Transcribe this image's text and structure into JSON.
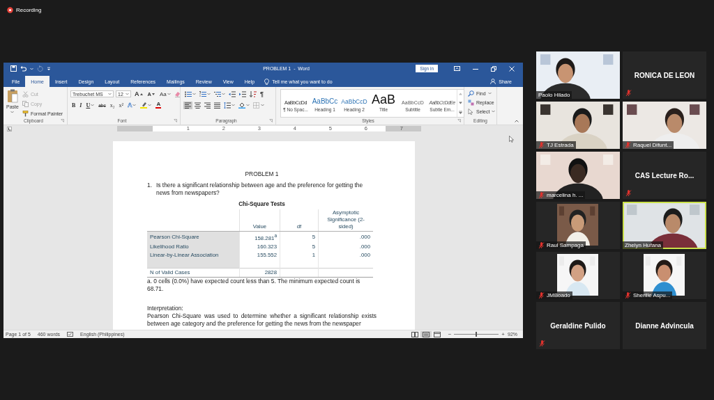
{
  "recording": {
    "label": "Recording"
  },
  "word": {
    "redo": {
      "disabled": true
    },
    "title": "PROBLEM 1  -  Word",
    "sign_in": "Sign in",
    "tabs": [
      {
        "label": "File",
        "selected": false
      },
      {
        "label": "Home",
        "selected": true
      },
      {
        "label": "Insert",
        "selected": false
      },
      {
        "label": "Design",
        "selected": false
      },
      {
        "label": "Layout",
        "selected": false
      },
      {
        "label": "References",
        "selected": false
      },
      {
        "label": "Mailings",
        "selected": false
      },
      {
        "label": "Review",
        "selected": false
      },
      {
        "label": "View",
        "selected": false
      },
      {
        "label": "Help",
        "selected": false
      }
    ],
    "tell_me": "Tell me what you want to do",
    "share": "Share",
    "clipboard": {
      "label": "Clipboard",
      "paste": "Paste",
      "items": [
        {
          "label": "Cut",
          "kind": "cut",
          "disabled": true
        },
        {
          "label": "Copy",
          "kind": "copy",
          "disabled": true
        },
        {
          "label": "Format Painter",
          "kind": "painter",
          "disabled": false
        }
      ]
    },
    "font": {
      "label": "Font",
      "name": "Trebuchet MS",
      "size": "12",
      "grow": "A",
      "shrink": "A",
      "change_case": "Aa",
      "formats": [
        {
          "label": "B",
          "kind": "bold"
        },
        {
          "label": "I",
          "kind": "italic"
        },
        {
          "label": "U",
          "kind": "underline"
        },
        {
          "label": "abc",
          "kind": "strike"
        },
        {
          "label": "x₂",
          "kind": "sub"
        },
        {
          "label": "x²",
          "kind": "sup"
        }
      ],
      "effects": "A",
      "font_color": "A"
    },
    "paragraph": {
      "label": "Paragraph",
      "show_marks": "¶",
      "alignment": [
        {
          "kind": "left",
          "selected": true
        },
        {
          "kind": "center",
          "selected": false
        },
        {
          "kind": "right",
          "selected": false
        },
        {
          "kind": "justify",
          "selected": false
        }
      ]
    },
    "styles": {
      "label": "Styles",
      "items": [
        {
          "preview": "AaBbCcDd",
          "name": "¶ No Spac...",
          "kind": "nospacing"
        },
        {
          "preview": "AaBbCc",
          "name": "Heading 1",
          "kind": "heading1"
        },
        {
          "preview": "AaBbCcD",
          "name": "Heading 2",
          "kind": "heading2"
        },
        {
          "preview": "AaB",
          "name": "Title",
          "kind": "title"
        },
        {
          "preview": "AaBbCcD",
          "name": "Subtitle",
          "kind": "subtitle"
        },
        {
          "preview": "AaBbCcDdEe",
          "name": "Subtle Em...",
          "kind": "subtle"
        }
      ]
    },
    "editing": {
      "label": "Editing",
      "items": [
        {
          "label": "Find",
          "kind": "find"
        },
        {
          "label": "Replace",
          "kind": "replace"
        },
        {
          "label": "Select",
          "kind": "select"
        }
      ]
    },
    "ruler": [
      "1",
      "2",
      "3",
      "4",
      "5",
      "6",
      "7"
    ],
    "document": {
      "heading": "PROBLEM 1",
      "question": {
        "number": "1.",
        "text": "Is there a significant relationship between age and the preference for getting the news from newspapers?"
      },
      "table": {
        "title": "Chi-Square Tests",
        "columns": [
          "Value",
          "df",
          "Asymptotic Significance (2-sided)"
        ],
        "rows": [
          {
            "label": "Pearson Chi-Square",
            "kind": "test",
            "cells": [
              "158.281$^{a}$",
              "5",
              ".000"
            ]
          },
          {
            "label": "Likelihood Ratio",
            "kind": "test",
            "cells": [
              "160.323",
              "5",
              ".000"
            ]
          },
          {
            "label": "Linear-by-Linear Association",
            "kind": "test",
            "cells": [
              "155.552",
              "1",
              ".000"
            ]
          },
          {
            "label": "N of Valid Cases",
            "kind": "total",
            "cells": [
              "2828"
            ]
          }
        ],
        "footnote": "a. 0 cells (0.0%) have expected count less than 5. The minimum expected count is 68.71."
      },
      "interpretation": {
        "label": "Interpretation:",
        "text": "Pearson Chi-Square was used to determine whether a significant relationship exists between age category and the preference for getting the news from the newspaper"
      }
    },
    "status": {
      "page": "Page 1 of 5",
      "words": "460 words",
      "language": "English (Philippines)",
      "views": [
        {
          "kind": "read",
          "selected": false
        },
        {
          "kind": "print",
          "selected": true
        },
        {
          "kind": "web",
          "selected": false
        }
      ],
      "zoom_out": "−",
      "zoom_in": "+",
      "zoom": {
        "level": 0.5,
        "reading": "92%"
      }
    }
  },
  "participants": [
    {
      "name": "Paolo Hilado",
      "kind": "video",
      "muted": false,
      "speaking": false
    },
    {
      "name": "RONICA DE LEON",
      "kind": "name",
      "muted": true,
      "speaking": false
    },
    {
      "name": "TJ Estrada",
      "kind": "video",
      "muted": true,
      "speaking": false
    },
    {
      "name": "Raquel Difunt...",
      "kind": "video",
      "muted": true,
      "speaking": false
    },
    {
      "name": "marcelina h. ...",
      "kind": "video",
      "muted": true,
      "speaking": false
    },
    {
      "name": "CAS Lecture Ro...",
      "kind": "name",
      "muted": true,
      "speaking": false
    },
    {
      "name": "Raul Sampaga",
      "muted": true,
      "speaking": false
    },
    {
      "name": "Zhelyn Hufana",
      "kind": "video",
      "muted": false,
      "speaking": true
    },
    {
      "name": "JMBoado",
      "muted": true,
      "speaking": false
    },
    {
      "name": "Sherille Aspu...",
      "muted": true,
      "speaking": false
    },
    {
      "name": "Geraldine Pulido",
      "kind": "name",
      "muted": true,
      "speaking": false
    },
    {
      "name": "Dianne Advincula",
      "kind": "name",
      "muted": false,
      "speaking": false
    }
  ]
}
